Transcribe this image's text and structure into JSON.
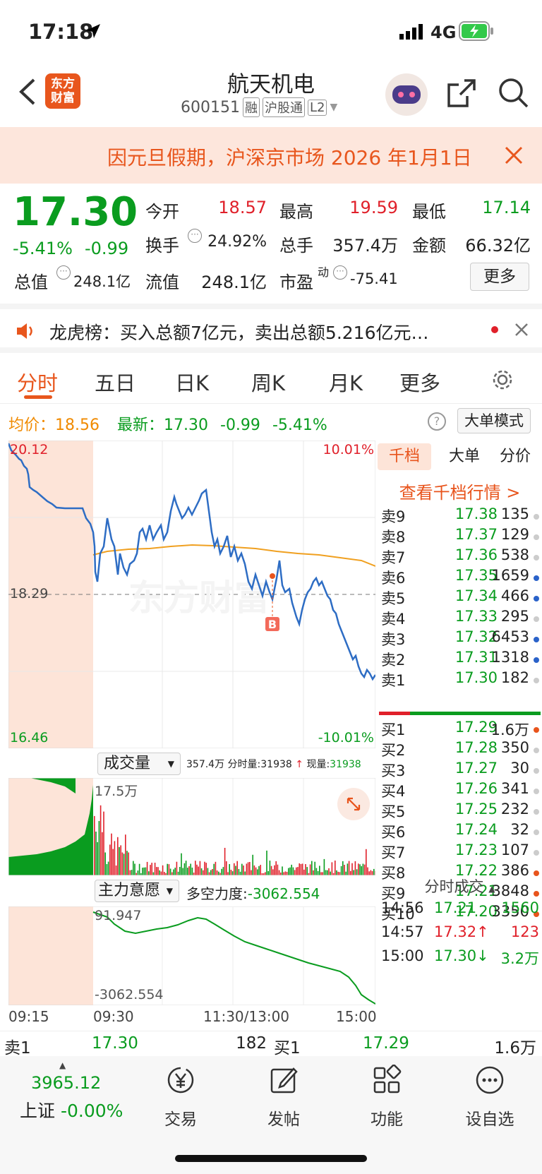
{
  "status": {
    "time": "17:18",
    "network": "4G"
  },
  "header": {
    "title": "航天机电",
    "code": "600151",
    "tags": [
      "融",
      "沪股通",
      "L2"
    ],
    "logo_line1": "东方",
    "logo_line2": "财富"
  },
  "banner": {
    "text": "因元旦假期，沪深京市场 2026 年1月1日"
  },
  "quote": {
    "price": "17.30",
    "change_pct": "-5.41%",
    "change": "-0.99",
    "open_label": "今开",
    "open": "18.57",
    "high_label": "最高",
    "high": "19.59",
    "low_label": "最低",
    "low": "17.14",
    "turnover_label": "换手",
    "turnover": "24.92%",
    "volume_label": "总手",
    "volume": "357.4万",
    "amount_label": "金额",
    "amount": "66.32亿",
    "mcap_label": "总值",
    "mcap": "248.1亿",
    "float_label": "流值",
    "float": "248.1亿",
    "pe_label": "市盈",
    "pe_sup": "动",
    "pe": "-75.41",
    "more_label": "更多"
  },
  "notice": {
    "text": "龙虎榜：买入总额7亿元，卖出总额5.216亿元…"
  },
  "tabs": [
    "分时",
    "五日",
    "日K",
    "周K",
    "月K",
    "更多"
  ],
  "pricebar": {
    "avg_label": "均价：",
    "avg": "18.56",
    "last_label": "最新：",
    "last": "17.30",
    "chg": "-0.99",
    "pct": "-5.41%",
    "mode_label": "大单模式"
  },
  "chart_labels": {
    "high_price": "20.12",
    "high_pct": "10.01%",
    "mid_price": "18.29",
    "low_price": "16.46",
    "low_pct": "-10.01%",
    "marker": "B"
  },
  "volume_panel": {
    "title": "成交量",
    "info_total": "357.4万",
    "info_label": "分时量:",
    "info_value": "31938",
    "now_label": "现量:",
    "now_value": "31938",
    "max_label": "17.5万"
  },
  "intent_panel": {
    "title": "主力意愿",
    "label": "多空力度:",
    "value": "-3062.554",
    "top": "91.947",
    "bottom": "-3062.554"
  },
  "time_axis": [
    "09:15",
    "09:30",
    "11:30/13:00",
    "15:00"
  ],
  "side": {
    "tabs": [
      "千档",
      "大单",
      "分价"
    ],
    "link": "查看千档行情 >",
    "sells": [
      {
        "label": "卖9",
        "price": "17.38",
        "vol": "135",
        "dot": "#cccccc"
      },
      {
        "label": "卖8",
        "price": "17.37",
        "vol": "129",
        "dot": "#cccccc"
      },
      {
        "label": "卖7",
        "price": "17.36",
        "vol": "538",
        "dot": "#cccccc"
      },
      {
        "label": "卖6",
        "price": "17.35",
        "vol": "1659",
        "dot": "#2a62c9"
      },
      {
        "label": "卖5",
        "price": "17.34",
        "vol": "466",
        "dot": "#2a62c9"
      },
      {
        "label": "卖4",
        "price": "17.33",
        "vol": "295",
        "dot": "#cccccc"
      },
      {
        "label": "卖3",
        "price": "17.32",
        "vol": "6453",
        "dot": "#2a62c9"
      },
      {
        "label": "卖2",
        "price": "17.31",
        "vol": "1318",
        "dot": "#2a62c9"
      },
      {
        "label": "卖1",
        "price": "17.30",
        "vol": "182",
        "dot": "#cccccc"
      }
    ],
    "buys": [
      {
        "label": "买1",
        "price": "17.29",
        "vol": "1.6万",
        "dot": "#e8541c"
      },
      {
        "label": "买2",
        "price": "17.28",
        "vol": "350",
        "dot": "#cccccc"
      },
      {
        "label": "买3",
        "price": "17.27",
        "vol": "30",
        "dot": "#cccccc"
      },
      {
        "label": "买4",
        "price": "17.26",
        "vol": "341",
        "dot": "#cccccc"
      },
      {
        "label": "买5",
        "price": "17.25",
        "vol": "232",
        "dot": "#cccccc"
      },
      {
        "label": "买6",
        "price": "17.24",
        "vol": "32",
        "dot": "#cccccc"
      },
      {
        "label": "买7",
        "price": "17.23",
        "vol": "107",
        "dot": "#cccccc"
      },
      {
        "label": "买8",
        "price": "17.22",
        "vol": "386",
        "dot": "#e8541c"
      },
      {
        "label": "买9",
        "price": "17.21",
        "vol": "3848",
        "dot": "#e8541c"
      },
      {
        "label": "买10",
        "price": "17.20",
        "vol": "3350",
        "dot": "#e8541c"
      }
    ],
    "trades_title": "分时成交",
    "trades": [
      {
        "time": "14:56",
        "price": "17.21",
        "arrow": "",
        "vol": "1560",
        "color": "#0a9c1f"
      },
      {
        "time": "14:57",
        "price": "17.32",
        "arrow": "↑",
        "vol": "123",
        "color": "#e0202a"
      },
      {
        "time": "15:00",
        "price": "17.30",
        "arrow": "↓",
        "vol": "3.2万",
        "color": "#0a9c1f"
      }
    ]
  },
  "bottom": {
    "sell_label": "卖1",
    "sell_price": "17.30",
    "sell_vol": "182",
    "buy_label": "买1",
    "buy_price": "17.29",
    "buy_vol": "1.6万"
  },
  "nav": {
    "index_value": "3965.12",
    "index_name": "上证",
    "index_pct": "-0.00%",
    "items": [
      "交易",
      "发帖",
      "功能",
      "设自选"
    ]
  }
}
